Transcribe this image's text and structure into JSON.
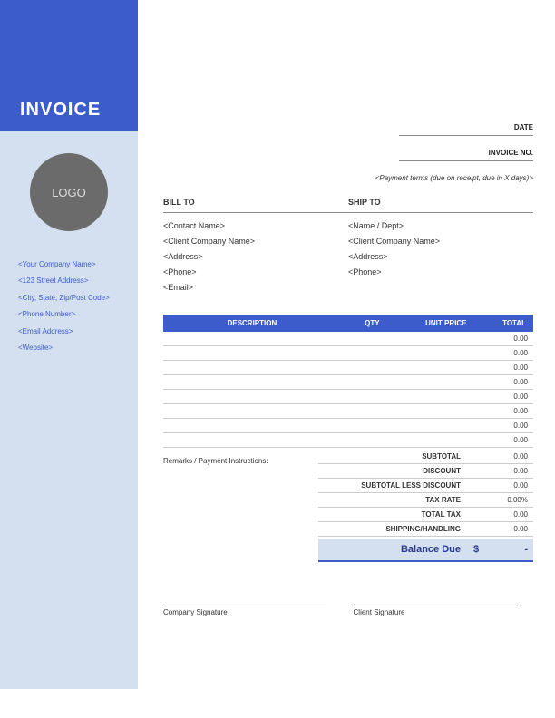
{
  "title": "INVOICE",
  "logo_text": "LOGO",
  "company": {
    "name": "<Your Company Name>",
    "address": "<123 Street Address>",
    "city_state_zip": "<City, State, Zip/Post Code>",
    "phone": "<Phone Number>",
    "email": "<Email Address>",
    "website": "<Website>"
  },
  "header": {
    "date_label": "DATE",
    "invoice_no_label": "INVOICE NO.",
    "payment_terms": "<Payment terms (due on receipt, due in X days)>"
  },
  "bill_to": {
    "heading": "BILL TO",
    "contact": "<Contact Name>",
    "company": "<Client Company Name>",
    "address": "<Address>",
    "phone": "<Phone>",
    "email": "<Email>"
  },
  "ship_to": {
    "heading": "SHIP TO",
    "name": "<Name / Dept>",
    "company": "<Client Company Name>",
    "address": "<Address>",
    "phone": "<Phone>"
  },
  "columns": {
    "description": "DESCRIPTION",
    "qty": "QTY",
    "unit_price": "UNIT PRICE",
    "total": "TOTAL"
  },
  "rows": [
    {
      "description": "",
      "qty": "",
      "unit_price": "",
      "total": "0.00"
    },
    {
      "description": "",
      "qty": "",
      "unit_price": "",
      "total": "0.00"
    },
    {
      "description": "",
      "qty": "",
      "unit_price": "",
      "total": "0.00"
    },
    {
      "description": "",
      "qty": "",
      "unit_price": "",
      "total": "0.00"
    },
    {
      "description": "",
      "qty": "",
      "unit_price": "",
      "total": "0.00"
    },
    {
      "description": "",
      "qty": "",
      "unit_price": "",
      "total": "0.00"
    },
    {
      "description": "",
      "qty": "",
      "unit_price": "",
      "total": "0.00"
    },
    {
      "description": "",
      "qty": "",
      "unit_price": "",
      "total": "0.00"
    }
  ],
  "remarks_label": "Remarks / Payment Instructions:",
  "totals": {
    "subtotal_label": "SUBTOTAL",
    "subtotal": "0.00",
    "discount_label": "DISCOUNT",
    "discount": "0.00",
    "subtotal_less_label": "SUBTOTAL LESS DISCOUNT",
    "subtotal_less": "0.00",
    "tax_rate_label": "TAX RATE",
    "tax_rate": "0.00%",
    "total_tax_label": "TOTAL TAX",
    "total_tax": "0.00",
    "shipping_label": "SHIPPING/HANDLING",
    "shipping": "0.00",
    "balance_label": "Balance Due",
    "balance_currency": "$",
    "balance": "-"
  },
  "signatures": {
    "company": "Company Signature",
    "client": "Client Signature"
  }
}
